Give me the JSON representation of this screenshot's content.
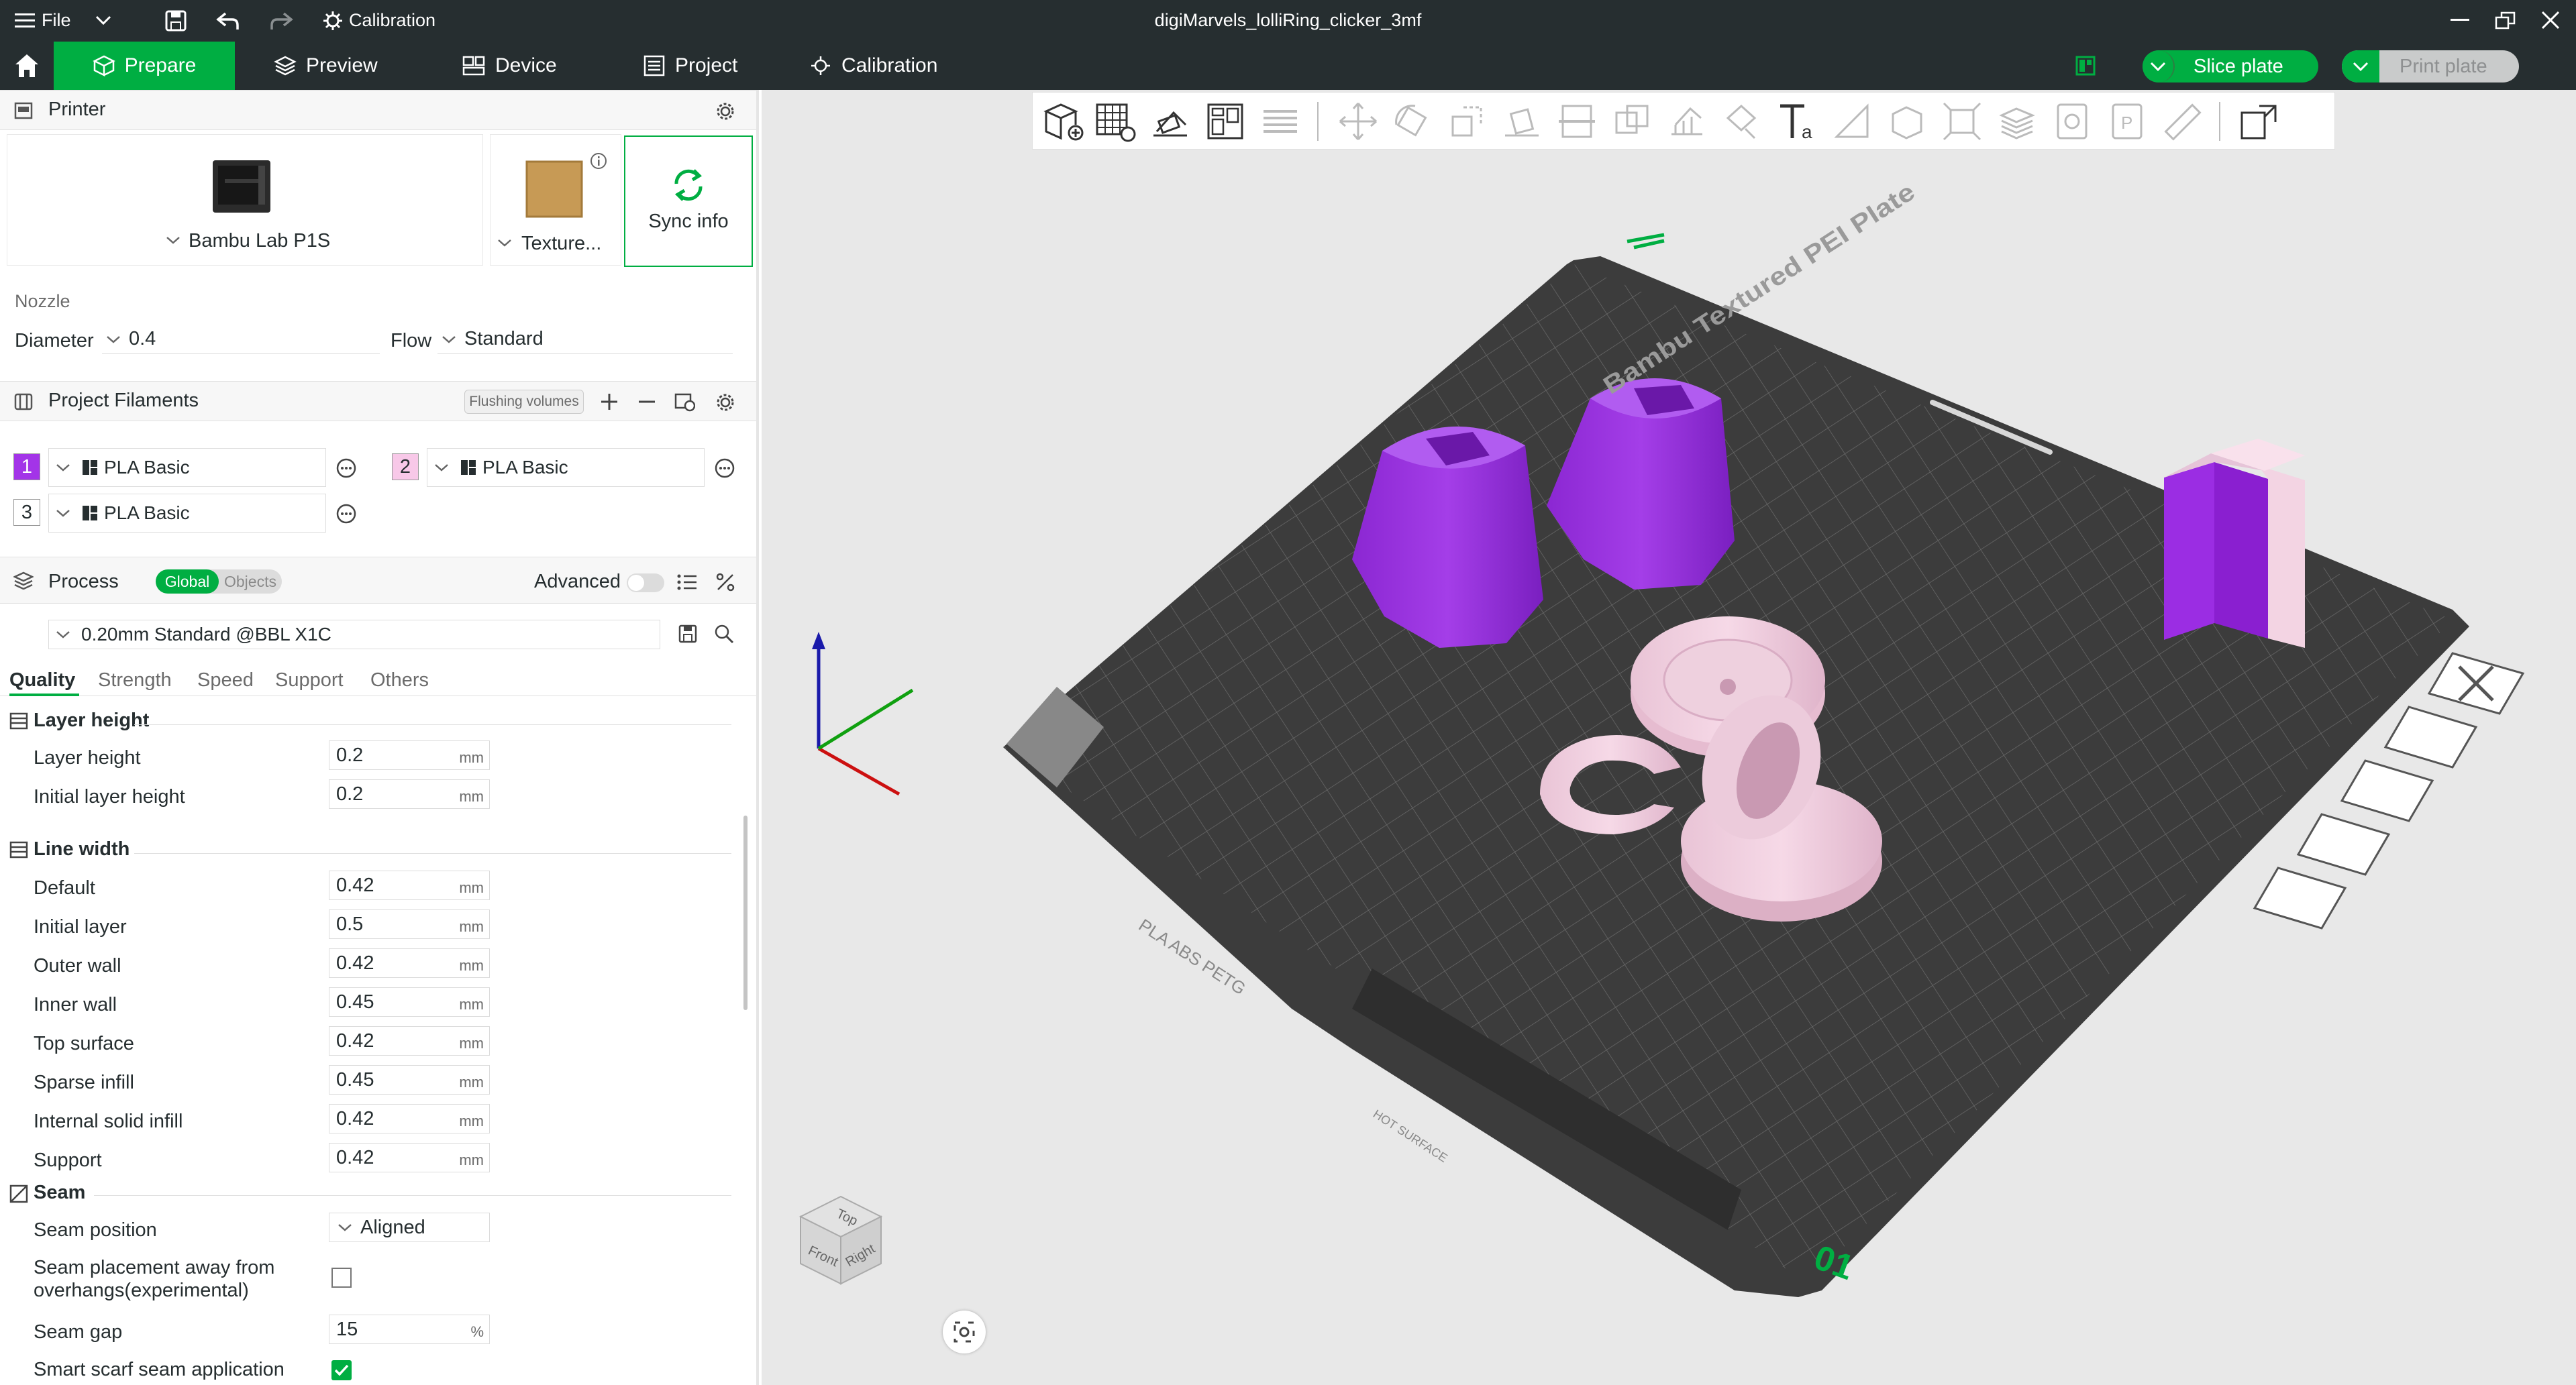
{
  "window": {
    "title": "digiMarvels_lolliRing_clicker_3mf",
    "menu_file": "File",
    "calibration_menu": "Calibration"
  },
  "tabs": {
    "prepare": "Prepare",
    "preview": "Preview",
    "device": "Device",
    "project": "Project",
    "calibration": "Calibration"
  },
  "actions": {
    "slice_plate": "Slice plate",
    "print_plate": "Print plate"
  },
  "printer": {
    "header": "Printer",
    "name": "Bambu Lab P1S",
    "plate": "Texture...",
    "sync": "Sync info",
    "nozzle_label": "Nozzle",
    "diameter_label": "Diameter",
    "diameter_value": "0.4",
    "flow_label": "Flow",
    "flow_value": "Standard"
  },
  "filaments": {
    "header": "Project Filaments",
    "flushing": "Flushing volumes",
    "items": [
      {
        "index": "1",
        "name": "PLA Basic",
        "color": "#a334e8"
      },
      {
        "index": "2",
        "name": "PLA Basic",
        "color": "#f8c8e8"
      },
      {
        "index": "3",
        "name": "PLA Basic",
        "color": "#ffffff"
      }
    ]
  },
  "process": {
    "header": "Process",
    "global": "Global",
    "objects": "Objects",
    "advanced": "Advanced",
    "preset": "0.20mm Standard @BBL X1C",
    "tabs": [
      "Quality",
      "Strength",
      "Speed",
      "Support",
      "Others"
    ],
    "layer_height": {
      "title": "Layer height",
      "rows": [
        {
          "label": "Layer height",
          "value": "0.2",
          "unit": "mm"
        },
        {
          "label": "Initial layer height",
          "value": "0.2",
          "unit": "mm"
        }
      ]
    },
    "line_width": {
      "title": "Line width",
      "rows": [
        {
          "label": "Default",
          "value": "0.42",
          "unit": "mm"
        },
        {
          "label": "Initial layer",
          "value": "0.5",
          "unit": "mm"
        },
        {
          "label": "Outer wall",
          "value": "0.42",
          "unit": "mm"
        },
        {
          "label": "Inner wall",
          "value": "0.45",
          "unit": "mm"
        },
        {
          "label": "Top surface",
          "value": "0.42",
          "unit": "mm"
        },
        {
          "label": "Sparse infill",
          "value": "0.45",
          "unit": "mm"
        },
        {
          "label": "Internal solid infill",
          "value": "0.42",
          "unit": "mm"
        },
        {
          "label": "Support",
          "value": "0.42",
          "unit": "mm"
        }
      ]
    },
    "seam": {
      "title": "Seam",
      "position_label": "Seam position",
      "position_value": "Aligned",
      "away_label_1": "Seam placement away from",
      "away_label_2": "overhangs(experimental)",
      "away_checked": false,
      "gap_label": "Seam gap",
      "gap_value": "15",
      "gap_unit": "%",
      "scarf_label": "Smart scarf seam application",
      "scarf_checked": true
    }
  },
  "plate": {
    "label": "Bambu Textured PEI Plate",
    "materials": "PLA ABS PETG",
    "hot": "HOT SURFACE",
    "number": "01"
  },
  "viewcube": {
    "top": "Top",
    "front": "Front",
    "right": "Right"
  },
  "colors": {
    "accent": "#00ae42",
    "dark": "#262e30",
    "purple": "#9b2de3",
    "pink": "#f1cde0"
  }
}
